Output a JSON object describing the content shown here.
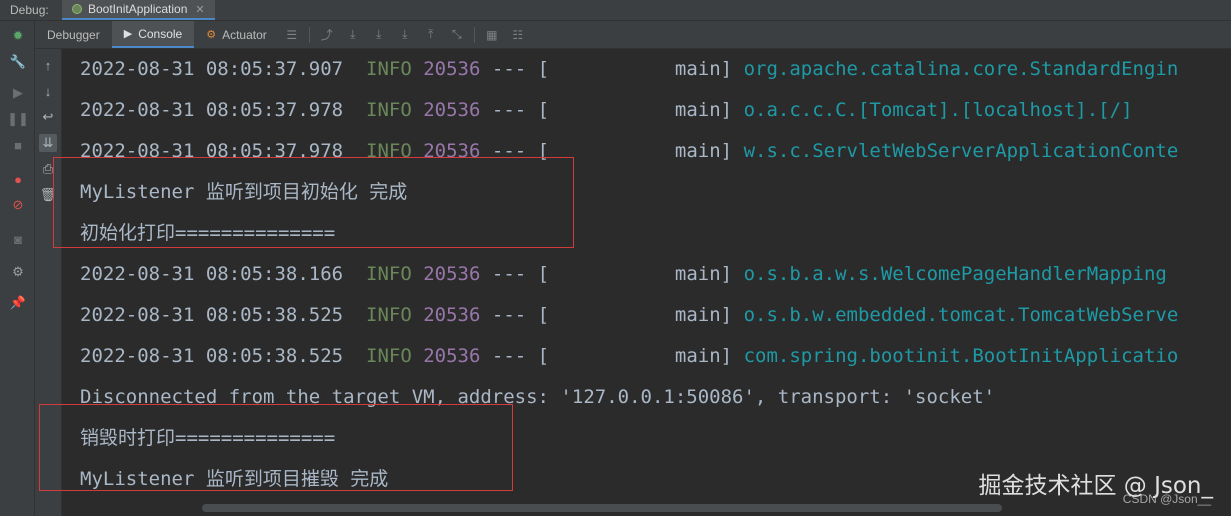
{
  "titlebar": {
    "label": "Debug:",
    "tab": "BootInitApplication"
  },
  "tabs": {
    "debugger": "Debugger",
    "console": "Console",
    "actuator": "Actuator"
  },
  "log": {
    "lines": [
      {
        "time": "2022-08-31 08:05:37.907",
        "level": "INFO",
        "pid": "20536",
        "sep": "--- [",
        "thread": "main]",
        "logger": "org.apache.catalina.core.StandardEngin"
      },
      {
        "time": "2022-08-31 08:05:37.978",
        "level": "INFO",
        "pid": "20536",
        "sep": "--- [",
        "thread": "main]",
        "logger": "o.a.c.c.C.[Tomcat].[localhost].[/]"
      },
      {
        "time": "2022-08-31 08:05:37.978",
        "level": "INFO",
        "pid": "20536",
        "sep": "--- [",
        "thread": "main]",
        "logger": "w.s.c.ServletWebServerApplicationConte"
      },
      {
        "time": "2022-08-31 08:05:38.166",
        "level": "INFO",
        "pid": "20536",
        "sep": "--- [",
        "thread": "main]",
        "logger": "o.s.b.a.w.s.WelcomePageHandlerMapping"
      },
      {
        "time": "2022-08-31 08:05:38.525",
        "level": "INFO",
        "pid": "20536",
        "sep": "--- [",
        "thread": "main]",
        "logger": "o.s.b.w.embedded.tomcat.TomcatWebServe"
      },
      {
        "time": "2022-08-31 08:05:38.525",
        "level": "INFO",
        "pid": "20536",
        "sep": "--- [",
        "thread": "main]",
        "logger": "com.spring.bootinit.BootInitApplicatio"
      }
    ],
    "init_msg_1": "MyListener 监听到项目初始化 完成",
    "init_msg_2": "初始化打印==============",
    "disconnect": "Disconnected from the target VM, address: '127.0.0.1:50086', transport: 'socket'",
    "destroy_msg_1": "销毁时打印==============",
    "destroy_msg_2": "MyListener 监听到项目摧毁 完成"
  },
  "watermark": {
    "main": "掘金技术社区 @ Json_",
    "sub": "CSDN @Json__"
  },
  "colors": {
    "info": "#6a8759",
    "pid": "#9876aa",
    "logger": "#1e9aa6",
    "highlight_box": "#d23b3b"
  }
}
